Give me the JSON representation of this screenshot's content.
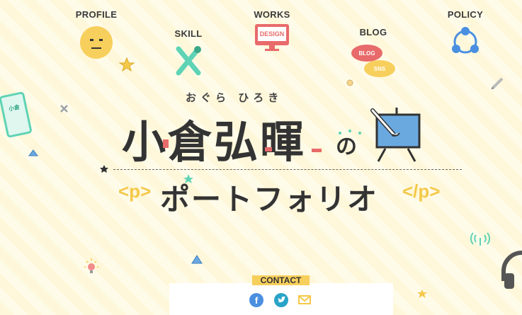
{
  "nav": {
    "profile": "PROFILE",
    "skill": "SKILL",
    "works": "WORKS",
    "blog": "BLOG",
    "policy": "POLICY"
  },
  "icons": {
    "works_screen_text": "DESIGN",
    "blog_bubble_1": "BLOG",
    "blog_bubble_2": "SNS",
    "phone_text": "小倉"
  },
  "hero": {
    "reading": "おぐら ひろき",
    "name": "小倉弘暉",
    "no": "の",
    "portfolio": "ポートフォリオ",
    "tag_open": "<p>",
    "tag_close": "</p>"
  },
  "contact": {
    "label": "CONTACT",
    "icons": [
      "facebook-icon",
      "twitter-icon",
      "mail-icon"
    ]
  },
  "colors": {
    "accent_yellow": "#f7cf5c",
    "accent_red": "#e86a6a",
    "accent_blue": "#4a8fe0",
    "accent_teal": "#5fd3b5",
    "text_dark": "#333333",
    "background_stripe_1": "#fff7d9",
    "background_stripe_2": "#fffbe9"
  }
}
